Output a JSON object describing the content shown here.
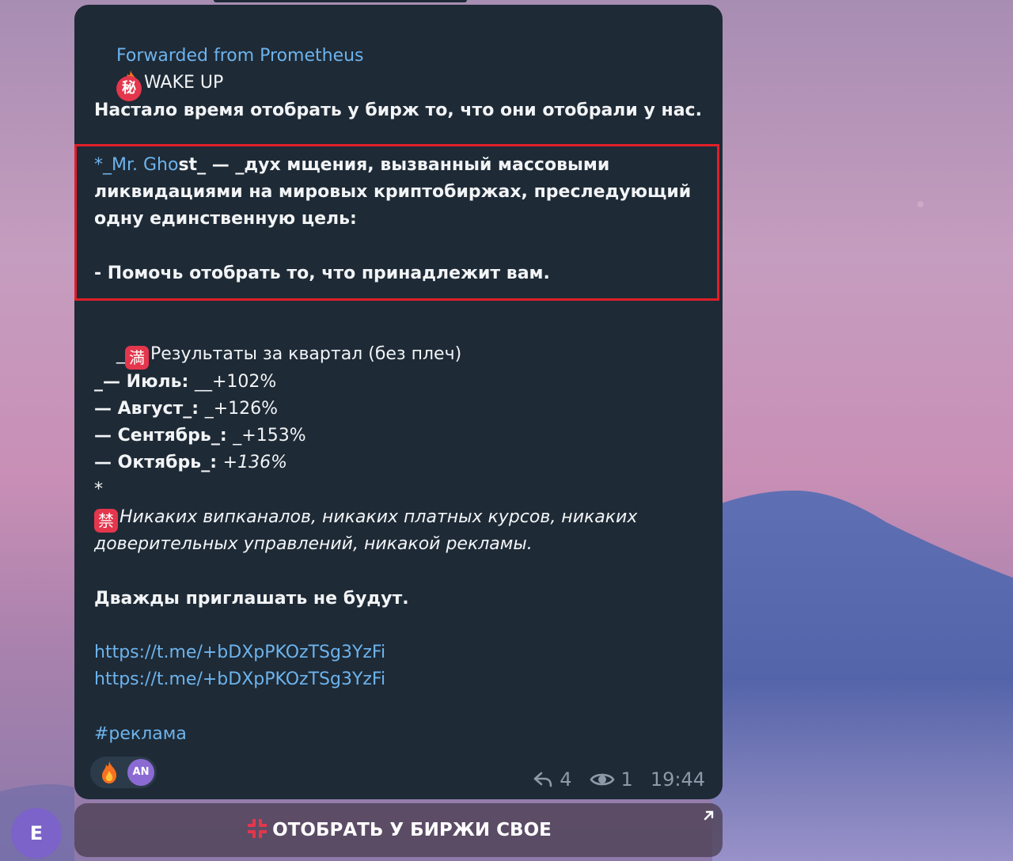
{
  "message": {
    "forwarded_label": "Forwarded from Prometheus",
    "wake_emoji": "秘",
    "wake_text": "WAKE UP",
    "intro": "Настало время отобрать у бирж то, что они отобрали у нас.",
    "ghost_prefix": "*_Mr. Gho",
    "ghost_suffix": "st_ — _дух мщения, вызванный массовыми",
    "ghost_line2": "ликвидациями на мировых криптобиржах, преследующий",
    "ghost_line3": "одну единственную цель:",
    "goal": "- Помочь отобрать то, что принадлежит вам.",
    "results_prefix": "_",
    "results_emoji": "満",
    "results_text": "Результаты за квартал (без плеч)",
    "months": [
      {
        "label": "_— Июль: ",
        "value": "__+102%"
      },
      {
        "label": "— Август_: ",
        "value": "_+126%"
      },
      {
        "label": "— Сентябрь_: ",
        "value": "_+153%"
      },
      {
        "label": "— Октябрь_: ",
        "value": "+136%"
      }
    ],
    "asterisk": "*",
    "ban_emoji": "禁",
    "ban_line1": "Никаких випканалов, никаких платных курсов, никаких",
    "ban_line2": "доверительных управлений, никакой рекламы.",
    "invite": "Дважды приглашать не будут.",
    "links": [
      "https://t.me/+bDXpPKOzTSg3YzFi",
      "https://t.me/+bDXpPKOzTSg3YzFi"
    ],
    "hashtag": "#реклама"
  },
  "reactions": {
    "avatar_initials": "AN",
    "icon": "fire-icon"
  },
  "meta": {
    "replies": "4",
    "views": "1",
    "time": "19:44"
  },
  "inline_button": {
    "label": "ОТОБРАТЬ У БИРЖИ СВОЕ",
    "icon": "anger-icon"
  },
  "sender_avatar": {
    "initial": "E"
  },
  "colors": {
    "bubble": "#1e2a36",
    "link": "#6db3ec",
    "highlight": "#e01f28",
    "avatar": "#7b63c9"
  }
}
